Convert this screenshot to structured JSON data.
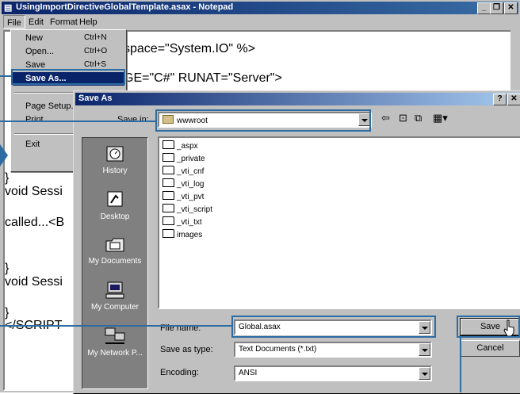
{
  "notepad": {
    "title": "UsingImportDirectiveGlobalTemplate.asax - Notepad",
    "menu": [
      "File",
      "Edit",
      "Format",
      "Help"
    ],
    "controls": [
      "_",
      "❐",
      "✕"
    ],
    "lines": [
      "space=\"System.IO\" %>",
      "GE=\"C#\" RUNAT=\"Server\">",
      "}",
      "void Sessi",
      "called...<B",
      "}",
      "void Sessi",
      "}",
      "</SCRIPT"
    ]
  },
  "file_menu": {
    "items": [
      {
        "label": "New",
        "shortcut": "Ctrl+N"
      },
      {
        "label": "Open...",
        "shortcut": "Ctrl+O"
      },
      {
        "label": "Save",
        "shortcut": "Ctrl+S"
      },
      {
        "label": "Save As...",
        "shortcut": ""
      },
      {
        "label": "Page Setup...",
        "shortcut": ""
      },
      {
        "label": "Print...",
        "shortcut": ""
      },
      {
        "label": "Exit",
        "shortcut": ""
      }
    ],
    "selected": "Save As..."
  },
  "dialog": {
    "title": "Save As",
    "help": "?",
    "close": "✕",
    "save_in_label": "Save in:",
    "save_in_value": "wwwroot",
    "places": [
      "History",
      "Desktop",
      "My Documents",
      "My Computer",
      "My Network P..."
    ],
    "files": [
      "_aspx",
      "_private",
      "_vti_cnf",
      "_vti_log",
      "_vti_pvt",
      "_vti_script",
      "_vti_txt",
      "images"
    ],
    "file_name_label": "File name:",
    "file_name_value": "Global.asax",
    "save_as_type_label": "Save as type:",
    "save_as_type_value": "Text Documents (*.txt)",
    "encoding_label": "Encoding:",
    "encoding_value": "ANSI",
    "save_button": "Save",
    "cancel_button": "Cancel"
  },
  "accent_color": "#2d6ca2",
  "titlebar_color": "#0a246a"
}
